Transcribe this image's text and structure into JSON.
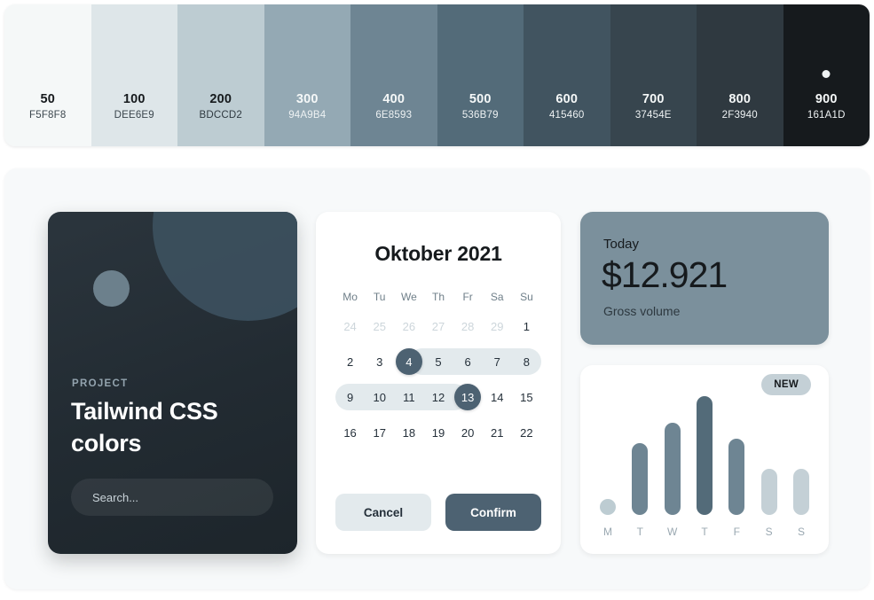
{
  "palette": {
    "swatches": [
      {
        "name": "50",
        "hex": "F5F8F8",
        "bg": "#F5F8F8",
        "fg": "#161A1D",
        "sub": "#3c474e",
        "dot": false
      },
      {
        "name": "100",
        "hex": "DEE6E9",
        "bg": "#DEE6E9",
        "fg": "#161A1D",
        "sub": "#3c474e",
        "dot": false
      },
      {
        "name": "200",
        "hex": "BDCCD2",
        "bg": "#BDCCD2",
        "fg": "#161A1D",
        "sub": "#2f3940",
        "dot": false
      },
      {
        "name": "300",
        "hex": "94A9B4",
        "bg": "#94A9B4",
        "fg": "#F5F8F8",
        "sub": "#eef2f3",
        "dot": false
      },
      {
        "name": "400",
        "hex": "6E8593",
        "bg": "#6E8593",
        "fg": "#F5F8F8",
        "sub": "#eef2f3",
        "dot": false
      },
      {
        "name": "500",
        "hex": "536B79",
        "bg": "#536B79",
        "fg": "#F5F8F8",
        "sub": "#eef2f3",
        "dot": false
      },
      {
        "name": "600",
        "hex": "415460",
        "bg": "#415460",
        "fg": "#F5F8F8",
        "sub": "#eef2f3",
        "dot": false
      },
      {
        "name": "700",
        "hex": "37454E",
        "bg": "#37454E",
        "fg": "#F5F8F8",
        "sub": "#eef2f3",
        "dot": false
      },
      {
        "name": "800",
        "hex": "2F3940",
        "bg": "#2F3940",
        "fg": "#F5F8F8",
        "sub": "#eef2f3",
        "dot": false
      },
      {
        "name": "900",
        "hex": "161A1D",
        "bg": "#161A1D",
        "fg": "#F5F8F8",
        "sub": "#eef2f3",
        "dot": true
      }
    ]
  },
  "project_card": {
    "eyebrow": "PROJECT",
    "title": "Tailwind CSS colors",
    "search_placeholder": "Search..."
  },
  "calendar": {
    "title": "Oktober 2021",
    "weekdays": [
      "Mo",
      "Tu",
      "We",
      "Th",
      "Fr",
      "Sa",
      "Su"
    ],
    "weeks": [
      [
        {
          "d": "24",
          "muted": true
        },
        {
          "d": "25",
          "muted": true
        },
        {
          "d": "26",
          "muted": true
        },
        {
          "d": "27",
          "muted": true
        },
        {
          "d": "28",
          "muted": true
        },
        {
          "d": "29",
          "muted": true
        },
        {
          "d": "1",
          "muted": false
        }
      ],
      [
        {
          "d": "2",
          "muted": false
        },
        {
          "d": "3",
          "muted": false
        },
        {
          "d": "4",
          "muted": false,
          "selected": true,
          "range": "start"
        },
        {
          "d": "5",
          "muted": false,
          "range": "mid"
        },
        {
          "d": "6",
          "muted": false,
          "range": "mid"
        },
        {
          "d": "7",
          "muted": false,
          "range": "mid"
        },
        {
          "d": "8",
          "muted": false,
          "range": "mid"
        }
      ],
      [
        {
          "d": "9",
          "muted": false,
          "range": "mid"
        },
        {
          "d": "10",
          "muted": false,
          "range": "mid"
        },
        {
          "d": "11",
          "muted": false,
          "range": "mid"
        },
        {
          "d": "12",
          "muted": false,
          "range": "mid"
        },
        {
          "d": "13",
          "muted": false,
          "selected": true,
          "range": "end"
        },
        {
          "d": "14",
          "muted": false
        },
        {
          "d": "15",
          "muted": false
        }
      ],
      [
        {
          "d": "16",
          "muted": false
        },
        {
          "d": "17",
          "muted": false
        },
        {
          "d": "18",
          "muted": false
        },
        {
          "d": "19",
          "muted": false
        },
        {
          "d": "20",
          "muted": false
        },
        {
          "d": "21",
          "muted": false
        },
        {
          "d": "22",
          "muted": false
        }
      ]
    ],
    "cancel_label": "Cancel",
    "confirm_label": "Confirm"
  },
  "stats": {
    "label": "Today",
    "value": "$12.921",
    "sublabel": "Gross volume"
  },
  "chart_card": {
    "badge": "NEW"
  },
  "chart_data": {
    "type": "bar",
    "title": "",
    "xlabel": "",
    "ylabel": "",
    "categories": [
      "M",
      "T",
      "W",
      "T",
      "F",
      "S",
      "S"
    ],
    "values": [
      16,
      74,
      95,
      122,
      78,
      47,
      47
    ],
    "ylim": [
      0,
      130
    ],
    "grid": false,
    "legend": false,
    "bar_colors": [
      "#BDCCD2",
      "#6E8593",
      "#6E8593",
      "#536B79",
      "#6E8593",
      "#C4D0D6",
      "#C4D0D6"
    ]
  }
}
